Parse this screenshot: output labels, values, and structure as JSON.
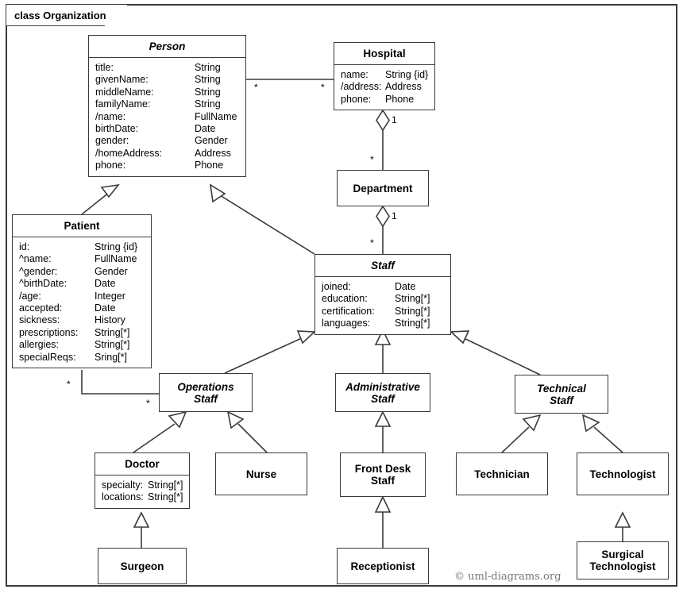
{
  "diagram": {
    "frame_label": "class Organization",
    "watermark": "© uml-diagrams.org",
    "colors": {
      "background": "#ffffff",
      "line": "#3a3a3a",
      "text": "#000000",
      "watermark": "#777777"
    }
  },
  "classes": {
    "person": {
      "name": "Person",
      "abstract": true,
      "attributes": [
        {
          "name": "title:",
          "type": "String"
        },
        {
          "name": "givenName:",
          "type": "String"
        },
        {
          "name": "middleName:",
          "type": "String"
        },
        {
          "name": "familyName:",
          "type": "String"
        },
        {
          "name": "/name:",
          "type": "FullName"
        },
        {
          "name": "birthDate:",
          "type": "Date"
        },
        {
          "name": "gender:",
          "type": "Gender"
        },
        {
          "name": "/homeAddress:",
          "type": "Address"
        },
        {
          "name": "phone:",
          "type": "Phone"
        }
      ]
    },
    "hospital": {
      "name": "Hospital",
      "abstract": false,
      "attributes": [
        {
          "name": "name:",
          "type": "String {id}"
        },
        {
          "name": "/address:",
          "type": "Address"
        },
        {
          "name": "phone:",
          "type": "Phone"
        }
      ]
    },
    "department": {
      "name": "Department",
      "abstract": false,
      "attributes": []
    },
    "patient": {
      "name": "Patient",
      "abstract": false,
      "attributes": [
        {
          "name": "id:",
          "type": "String {id}"
        },
        {
          "name": "^name:",
          "type": "FullName"
        },
        {
          "name": "^gender:",
          "type": "Gender"
        },
        {
          "name": "^birthDate:",
          "type": "Date"
        },
        {
          "name": "/age:",
          "type": "Integer"
        },
        {
          "name": "accepted:",
          "type": "Date"
        },
        {
          "name": "sickness:",
          "type": "History"
        },
        {
          "name": "prescriptions:",
          "type": "String[*]"
        },
        {
          "name": "allergies:",
          "type": "String[*]"
        },
        {
          "name": "specialReqs:",
          "type": "Sring[*]"
        }
      ]
    },
    "staff": {
      "name": "Staff",
      "abstract": true,
      "attributes": [
        {
          "name": "joined:",
          "type": "Date"
        },
        {
          "name": "education:",
          "type": "String[*]"
        },
        {
          "name": "certification:",
          "type": "String[*]"
        },
        {
          "name": "languages:",
          "type": "String[*]"
        }
      ]
    },
    "operations_staff": {
      "name": "Operations\nStaff",
      "abstract": true,
      "attributes": []
    },
    "administrative_staff": {
      "name": "Administrative\nStaff",
      "abstract": true,
      "attributes": []
    },
    "technical_staff": {
      "name": "Technical\nStaff",
      "abstract": true,
      "attributes": []
    },
    "doctor": {
      "name": "Doctor",
      "abstract": false,
      "attributes": [
        {
          "name": "specialty:",
          "type": "String[*]"
        },
        {
          "name": "locations:",
          "type": "String[*]"
        }
      ]
    },
    "nurse": {
      "name": "Nurse",
      "abstract": false,
      "attributes": []
    },
    "front_desk_staff": {
      "name": "Front Desk\nStaff",
      "abstract": false,
      "attributes": []
    },
    "technician": {
      "name": "Technician",
      "abstract": false,
      "attributes": []
    },
    "technologist": {
      "name": "Technologist",
      "abstract": false,
      "attributes": []
    },
    "surgeon": {
      "name": "Surgeon",
      "abstract": false,
      "attributes": []
    },
    "receptionist": {
      "name": "Receptionist",
      "abstract": false,
      "attributes": []
    },
    "surgical_technologist": {
      "name": "Surgical\nTechnologist",
      "abstract": false,
      "attributes": []
    }
  },
  "multiplicities": {
    "person_hospital_person_end": "*",
    "person_hospital_hospital_end": "*",
    "hospital_department_hospital_end": "1",
    "hospital_department_department_end": "*",
    "department_staff_department_end": "1",
    "department_staff_staff_end": "*",
    "patient_operations_patient_end": "*",
    "patient_operations_operations_end": "*"
  },
  "relationships": [
    {
      "type": "association",
      "source": "person",
      "target": "hospital"
    },
    {
      "type": "aggregation",
      "source": "hospital",
      "target": "department"
    },
    {
      "type": "aggregation",
      "source": "department",
      "target": "staff"
    },
    {
      "type": "association",
      "source": "patient",
      "target": "operations_staff"
    },
    {
      "type": "generalization",
      "source": "patient",
      "target": "person"
    },
    {
      "type": "generalization",
      "source": "staff",
      "target": "person"
    },
    {
      "type": "generalization",
      "source": "operations_staff",
      "target": "staff"
    },
    {
      "type": "generalization",
      "source": "administrative_staff",
      "target": "staff"
    },
    {
      "type": "generalization",
      "source": "technical_staff",
      "target": "staff"
    },
    {
      "type": "generalization",
      "source": "doctor",
      "target": "operations_staff"
    },
    {
      "type": "generalization",
      "source": "nurse",
      "target": "operations_staff"
    },
    {
      "type": "generalization",
      "source": "front_desk_staff",
      "target": "administrative_staff"
    },
    {
      "type": "generalization",
      "source": "technician",
      "target": "technical_staff"
    },
    {
      "type": "generalization",
      "source": "technologist",
      "target": "technical_staff"
    },
    {
      "type": "generalization",
      "source": "surgeon",
      "target": "doctor"
    },
    {
      "type": "generalization",
      "source": "receptionist",
      "target": "front_desk_staff"
    },
    {
      "type": "generalization",
      "source": "surgical_technologist",
      "target": "technologist"
    }
  ]
}
